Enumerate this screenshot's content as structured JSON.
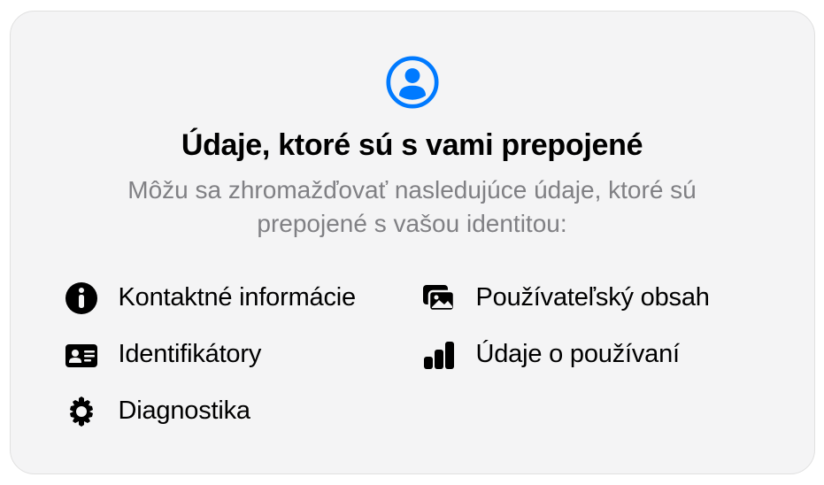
{
  "header": {
    "title": "Údaje, ktoré sú s vami prepojené",
    "subtitle": "Môžu sa zhromažďovať nasledujúce údaje, ktoré sú prepojené s vašou identitou:"
  },
  "items": [
    {
      "icon": "info-icon",
      "label": "Kontaktné informácie"
    },
    {
      "icon": "user-content-icon",
      "label": "Používateľský obsah"
    },
    {
      "icon": "identifiers-icon",
      "label": "Identifikátory"
    },
    {
      "icon": "usage-data-icon",
      "label": "Údaje o používaní"
    },
    {
      "icon": "diagnostics-icon",
      "label": "Diagnostika"
    }
  ]
}
